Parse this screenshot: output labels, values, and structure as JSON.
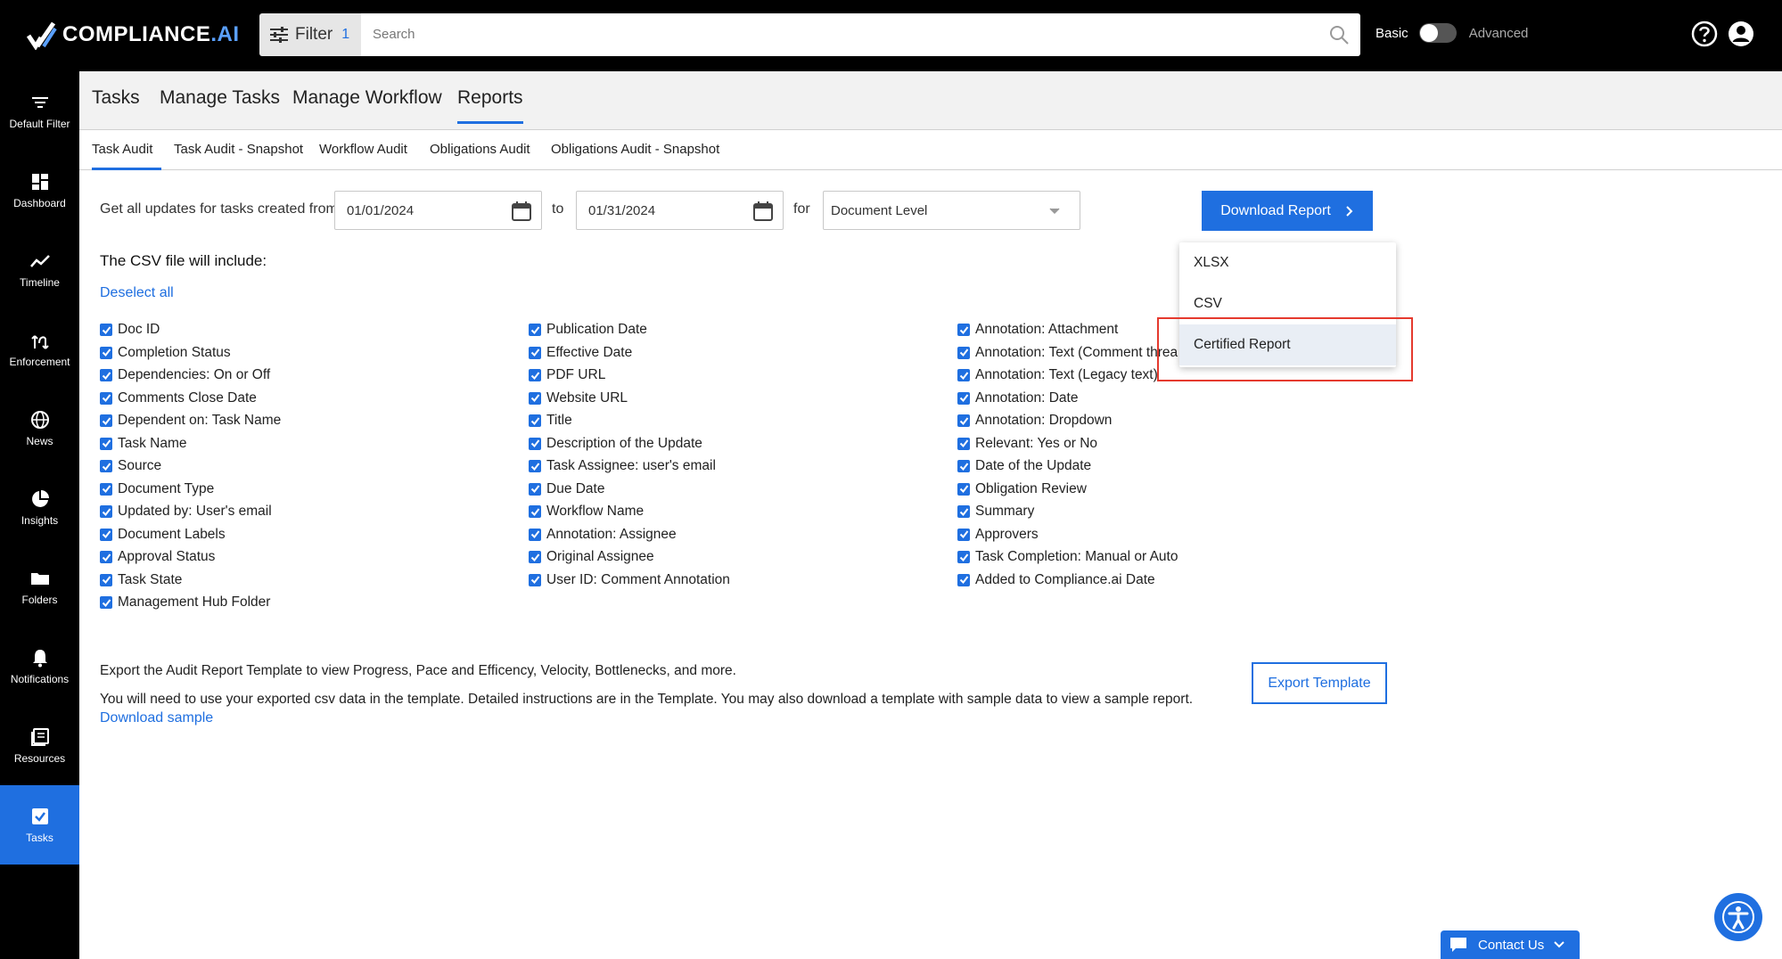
{
  "app": {
    "logo_text": "COMPLIANCE",
    "logo_suffix": ".AI",
    "filter_label": "Filter",
    "filter_count": "1",
    "search_placeholder": "Search",
    "mode_basic": "Basic",
    "mode_advanced": "Advanced"
  },
  "sidebar": {
    "items": [
      {
        "label": "Default Filter",
        "icon": "filter-lines-icon"
      },
      {
        "label": "Dashboard",
        "icon": "dashboard-icon"
      },
      {
        "label": "Timeline",
        "icon": "timeline-icon"
      },
      {
        "label": "Enforcement",
        "icon": "enforcement-icon"
      },
      {
        "label": "News",
        "icon": "globe-icon"
      },
      {
        "label": "Insights",
        "icon": "pie-chart-icon"
      },
      {
        "label": "Folders",
        "icon": "folder-icon"
      },
      {
        "label": "Notifications",
        "icon": "bell-icon"
      },
      {
        "label": "Resources",
        "icon": "book-icon"
      },
      {
        "label": "Tasks",
        "icon": "checkbox-icon"
      }
    ],
    "active": "Tasks"
  },
  "main_tabs": [
    "Tasks",
    "Manage Tasks",
    "Manage Workflow",
    "Reports"
  ],
  "sub_tabs": [
    "Task Audit",
    "Task Audit - Snapshot",
    "Workflow Audit",
    "Obligations Audit",
    "Obligations Audit - Snapshot"
  ],
  "form": {
    "prefix": "Get all updates for tasks created from",
    "from_date": "01/01/2024",
    "to_label": "to",
    "to_date": "01/31/2024",
    "for_label": "for",
    "level": "Document Level",
    "download_label": "Download Report"
  },
  "dropdown": {
    "items": [
      "XLSX",
      "CSV",
      "Certified Report"
    ],
    "highlighted": "Certified Report"
  },
  "csv": {
    "heading": "The CSV file will include:",
    "deselect": "Deselect all",
    "col1": [
      "Doc ID",
      "Completion Status",
      "Dependencies: On or Off",
      "Comments Close Date",
      "Dependent on: Task Name",
      "Task Name",
      "Source",
      "Document Type",
      "Updated by: User's email",
      "Document Labels",
      "Approval Status",
      "Task State",
      "Management Hub Folder"
    ],
    "col2": [
      "Publication Date",
      "Effective Date",
      "PDF URL",
      "Website URL",
      "Title",
      "Description of the Update",
      "Task Assignee: user's email",
      "Due Date",
      "Workflow Name",
      "Annotation: Assignee",
      "Original Assignee",
      "User ID: Comment Annotation"
    ],
    "col3": [
      "Annotation: Attachment",
      "Annotation: Text (Comment threa",
      "Annotation: Text (Legacy text)",
      "Annotation: Date",
      "Annotation: Dropdown",
      "Relevant: Yes or No",
      "Date of the Update",
      "Obligation Review",
      "Summary",
      "Approvers",
      "Task Completion: Manual or Auto",
      "Added to Compliance.ai Date"
    ]
  },
  "export": {
    "line1": "Export the Audit Report Template to view Progress, Pace and Efficency, Velocity, Bottlenecks, and more.",
    "line2": "You will need to use your exported csv data in the template. Detailed instructions are in the Template. You may also download a template with sample data to view a sample report.",
    "sample_link": "Download sample",
    "button": "Export Template"
  },
  "contact_label": "Contact Us",
  "colors": {
    "accent": "#1f6fe0",
    "highlight_box": "#e53a2e"
  }
}
